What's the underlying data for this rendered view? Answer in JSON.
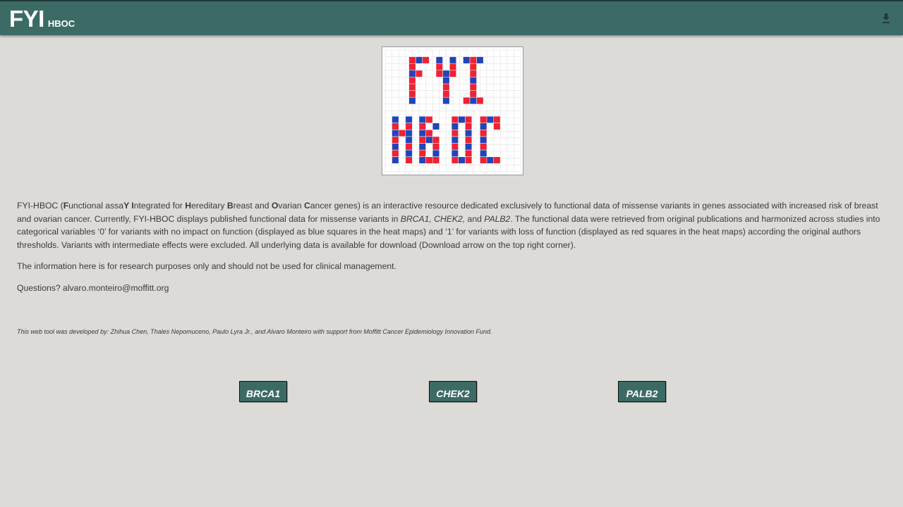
{
  "header": {
    "brand": "FYI",
    "brand_sub": "HBOC"
  },
  "logo": {
    "colors": {
      "red": "#ee2233",
      "blue": "#2244bb"
    }
  },
  "intro": {
    "a1": "FYI-HBOC (",
    "b1": "F",
    "a2": "unctional assa",
    "b2": "Y I",
    "a3": "ntegrated for ",
    "b3": "H",
    "a4": "ereditary ",
    "b4": "B",
    "a5": "reast and ",
    "b5": "O",
    "a6": "varian ",
    "b6": "C",
    "a7": "ancer genes) is an interactive resource dedicated exclusively to functional data of missense variants in genes associated with increased risk of breast and ovarian cancer. Currently, FYI-HBOC displays published functional data for missense variants in ",
    "gene1": "BRCA1, CHEK2,",
    "a8": " and ",
    "gene2": "PALB2",
    "a9": ". The functional data were retrieved from original publications and harmonized across studies into categorical variables ‘0’ for variants with no impact on function (displayed as blue squares in the heat maps) and ‘1’ for variants with loss of function (displayed as red squares in the heat maps) according the original authors thresholds. Variants with intermediate effects were excluded. All underlying data is available for download (Download arrow on the top right corner)."
  },
  "disclaimer": "The information here is for research purposes only and should not be used for clinical management.",
  "questions": "Questions? alvaro.monteiro@moffitt.org",
  "credit": "This web tool was developed by: Zhihua Chen, Thales Nepomuceno, Paulo Lyra Jr., and Alvaro Monteiro with support from Moffitt Cancer Epidemiology Innovation Fund.",
  "buttons": {
    "brca1": "BRCA1",
    "chek2": "CHEK2",
    "palb2": "PALB2"
  },
  "colors": {
    "header_bg": "#3c6b66",
    "page_bg": "#dcdbd7"
  }
}
